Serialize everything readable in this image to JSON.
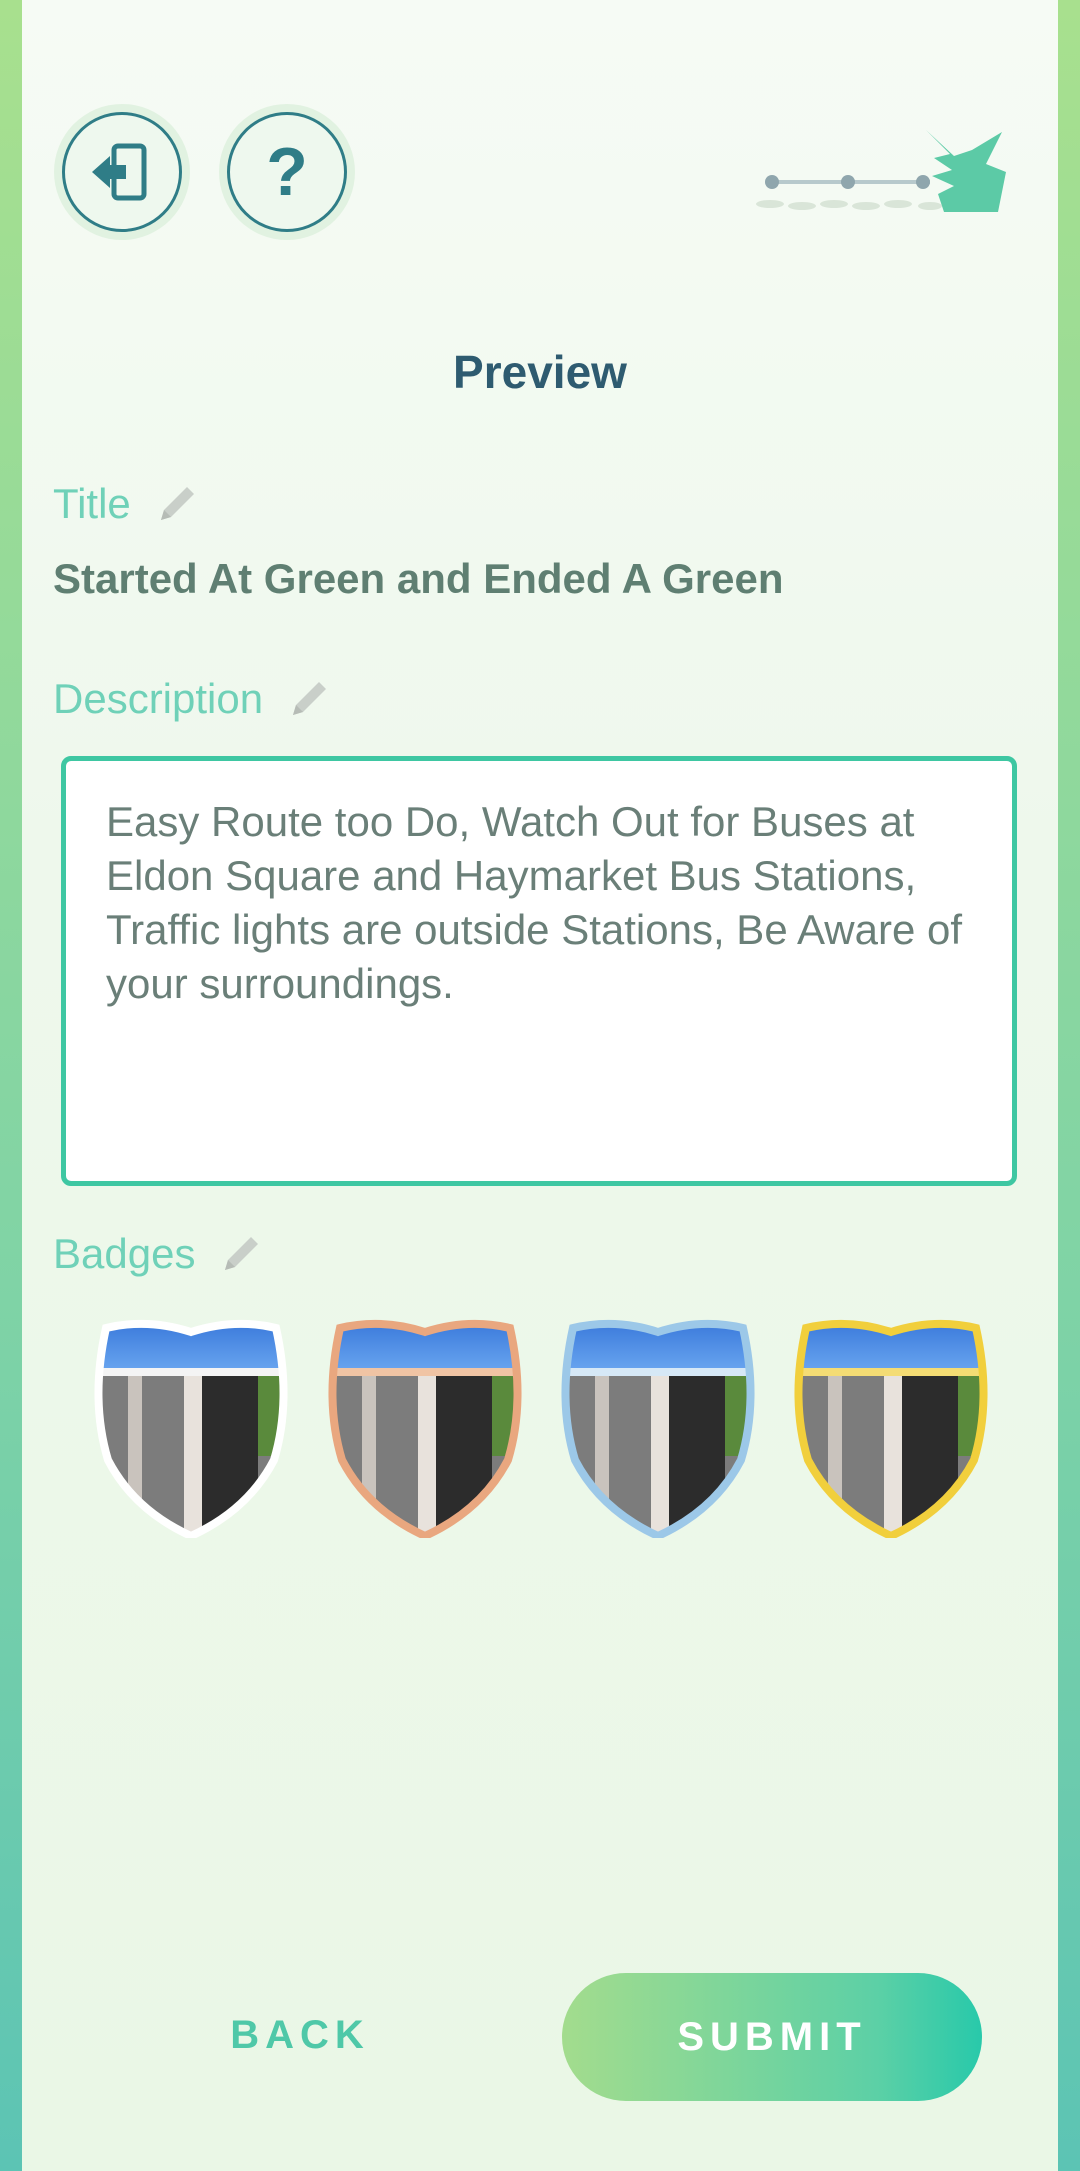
{
  "header": {
    "exit_icon": "exit-door-icon",
    "help_label": "?",
    "progress_steps_total": 4,
    "progress_steps_completed": 4
  },
  "page": {
    "title": "Preview"
  },
  "title_section": {
    "label": "Title",
    "value": "Started At Green and Ended A Green"
  },
  "description_section": {
    "label": "Description",
    "value": "Easy Route too Do, Watch Out for Buses at Eldon Square and Haymarket Bus Stations, Traffic lights are outside Stations, Be Aware of your surroundings."
  },
  "badges_section": {
    "label": "Badges",
    "badges": [
      {
        "tier": "base",
        "border_color": "#ffffff"
      },
      {
        "tier": "bronze",
        "border_color": "#e9a77f"
      },
      {
        "tier": "silver",
        "border_color": "#9cc8e8"
      },
      {
        "tier": "gold",
        "border_color": "#f1cf3c"
      }
    ]
  },
  "footer": {
    "back_label": "BACK",
    "submit_label": "SUBMIT"
  },
  "colors": {
    "accent": "#3ec7a2",
    "label": "#6fd1b8",
    "title_text": "#2e5b70",
    "icon": "#2f7d87"
  }
}
